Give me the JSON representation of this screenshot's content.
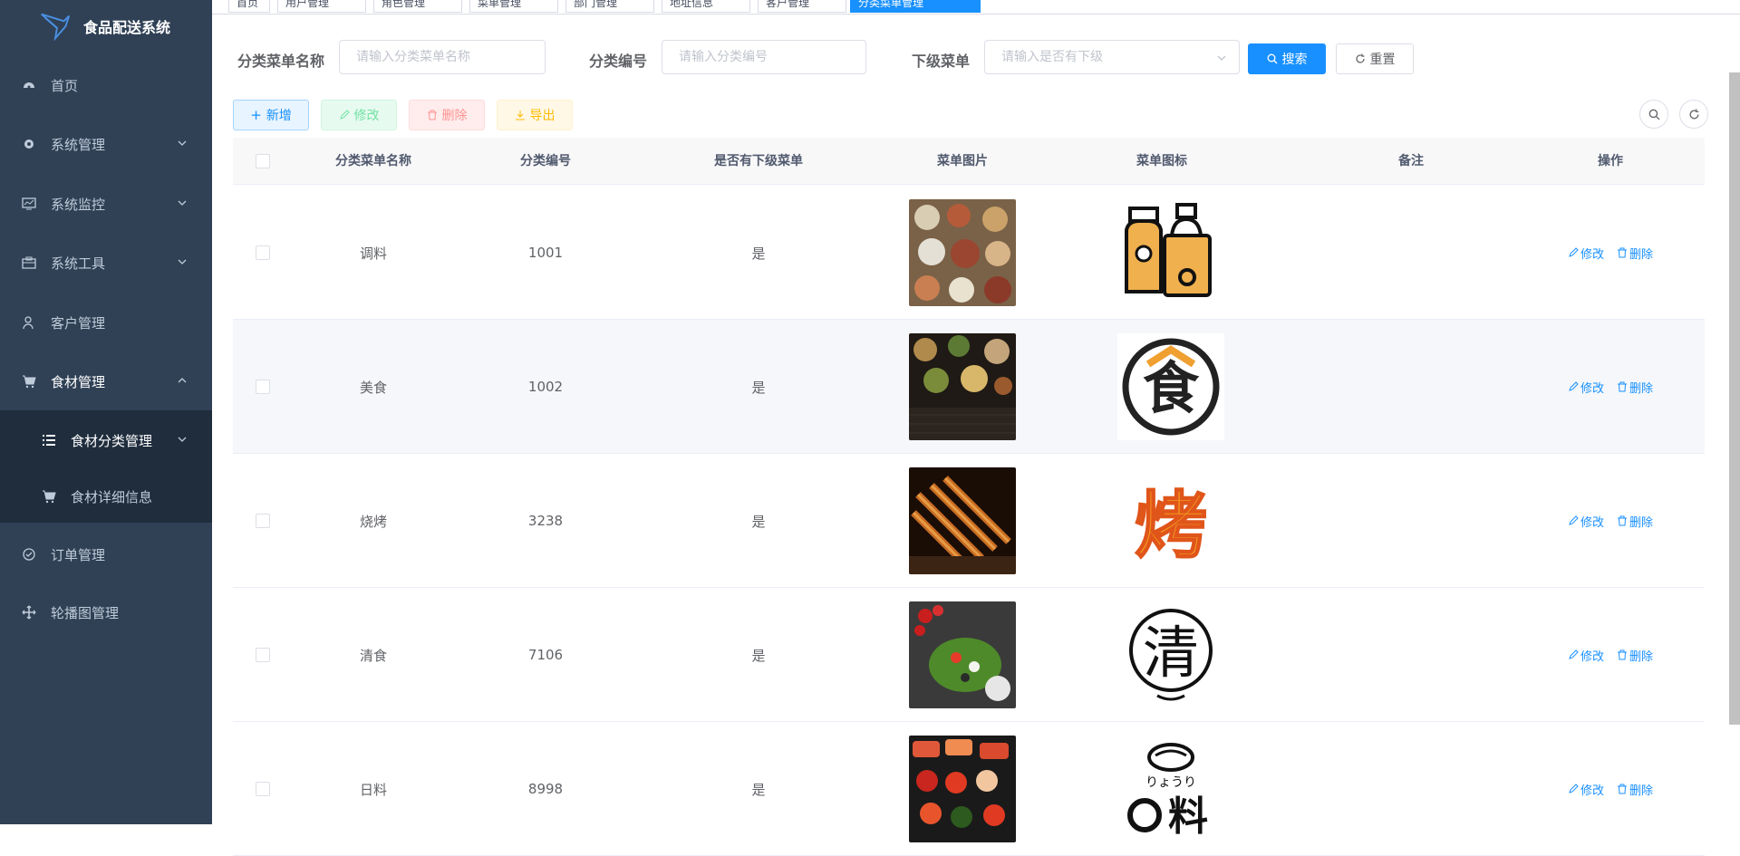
{
  "app": {
    "title": "食品配送系统"
  },
  "sidebar": {
    "items": [
      {
        "label": "首页"
      },
      {
        "label": "系统管理"
      },
      {
        "label": "系统监控"
      },
      {
        "label": "系统工具"
      },
      {
        "label": "客户管理"
      },
      {
        "label": "食材管理"
      },
      {
        "label": "订单管理"
      },
      {
        "label": "轮播图管理"
      }
    ],
    "sub_items": [
      {
        "label": "食材分类管理"
      },
      {
        "label": "食材详细信息"
      }
    ]
  },
  "tags": [
    "首页",
    "用户管理",
    "角色管理",
    "菜单管理",
    "部门管理",
    "地址信息",
    "客户管理",
    "分类菜单管理"
  ],
  "query": {
    "name_label": "分类菜单名称",
    "name_placeholder": "请输入分类菜单名称",
    "code_label": "分类编号",
    "code_placeholder": "请输入分类编号",
    "sub_label": "下级菜单",
    "sub_placeholder": "请输入是否有下级",
    "search_btn": "搜索",
    "reset_btn": "重置"
  },
  "toolbar": {
    "add": "新增",
    "edit": "修改",
    "delete": "删除",
    "export": "导出"
  },
  "table": {
    "columns": [
      "分类菜单名称",
      "分类编号",
      "是否有下级菜单",
      "菜单图片",
      "菜单图标",
      "备注",
      "操作"
    ],
    "rows": [
      {
        "name": "调料",
        "code": "1001",
        "has_sub": "是",
        "edit": "修改",
        "delete": "删除"
      },
      {
        "name": "美食",
        "code": "1002",
        "has_sub": "是",
        "edit": "修改",
        "delete": "删除"
      },
      {
        "name": "烧烤",
        "code": "3238",
        "has_sub": "是",
        "edit": "修改",
        "delete": "删除"
      },
      {
        "name": "清食",
        "code": "7106",
        "has_sub": "是",
        "edit": "修改",
        "delete": "删除"
      },
      {
        "name": "日料",
        "code": "8998",
        "has_sub": "是",
        "edit": "修改",
        "delete": "删除"
      }
    ]
  },
  "icons": {
    "row1_icon_text": "食",
    "row2_icon_text": "烤",
    "row3_icon_text": "清",
    "row4_icon_text": "料",
    "row4_icon_kana": "りょうり"
  },
  "colors": {
    "sidebar": "#304156",
    "primary": "#1890ff",
    "success": "#13ce66",
    "danger": "#ff4949",
    "warning": "#ffba00"
  }
}
